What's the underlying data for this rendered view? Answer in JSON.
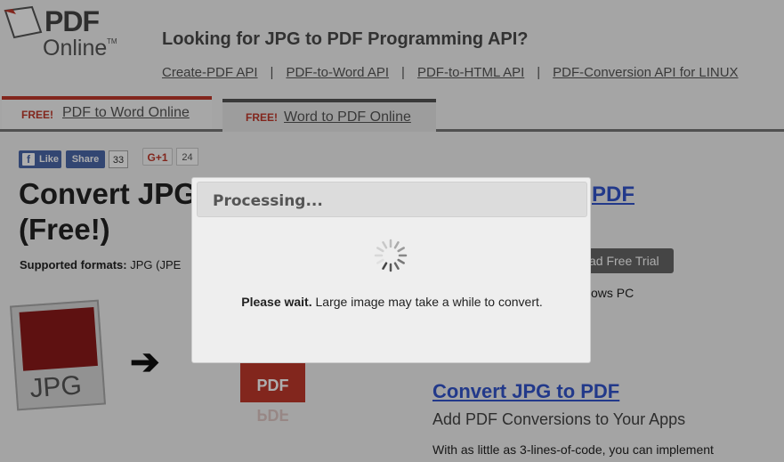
{
  "header": {
    "logo_pdf": "PDF",
    "logo_online": "Online",
    "logo_tm": "TM",
    "headline": "Looking for JPG to PDF Programming API?",
    "api_links": [
      "Create-PDF API",
      "PDF-to-Word API",
      "PDF-to-HTML API",
      "PDF-Conversion API for LINUX"
    ],
    "separator": "|"
  },
  "tabs": [
    {
      "free": "FREE!",
      "label": "PDF to Word Online"
    },
    {
      "free": "FREE!",
      "label": "Word to PDF Online"
    }
  ],
  "social": {
    "like_label": "Like",
    "share_label": "Share",
    "share_count": "33",
    "gplus_label": "G+1",
    "gplus_count": "24"
  },
  "main": {
    "title_line1": "Convert JPG",
    "title_line2": "(Free!)",
    "formats_label": "Supported formats:",
    "formats_value": "JPG (JPE",
    "right_title": "PDF",
    "trial_button": "ad Free Trial",
    "windows_text": "ows PC",
    "jpg_label": "JPG",
    "pdf_label": "PDF",
    "convert_link": "Convert JPG to PDF",
    "convert_sub": "Add PDF Conversions to Your Apps",
    "convert_desc": "With as little as 3-lines-of-code, you can implement"
  },
  "modal": {
    "title": "Processing...",
    "wait_bold": "Please wait.",
    "wait_text": " Large image may take a while to convert."
  },
  "colors": {
    "accent_red": "#c0392b",
    "link_blue": "#3355cc",
    "facebook_blue": "#4a67a8"
  }
}
